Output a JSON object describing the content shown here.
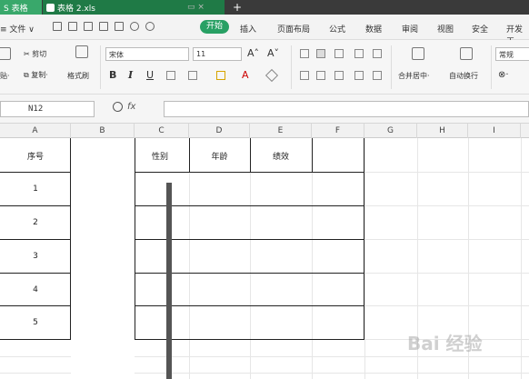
{
  "titlebar": {
    "app_tab": "S 表格",
    "doc_tab": "表格 2.xls",
    "add_tab_icon": "plus-icon"
  },
  "menubar": {
    "file_label": "≡ 文件 ∨",
    "tabs": [
      "开始",
      "插入",
      "页面布局",
      "公式",
      "数据",
      "审阅",
      "视图",
      "安全",
      "开发工"
    ]
  },
  "ribbon": {
    "cut_label": "剪切",
    "paste_label": "贴·",
    "copy_label": "复制·",
    "format_painter_label": "格式刷",
    "font_name": "宋体",
    "font_size": "11",
    "bold": "B",
    "italic": "I",
    "underline": "U",
    "merge_label": "合并居中·",
    "wrap_label": "自动换行",
    "number_format": "常规"
  },
  "formulabar": {
    "cell_ref": "N12",
    "fx_label": "fx",
    "formula_value": ""
  },
  "columns": [
    "A",
    "B",
    "C",
    "D",
    "E",
    "F",
    "G",
    "H",
    "I"
  ],
  "table": {
    "headers": [
      "序号",
      "性别",
      "年龄",
      "绩效"
    ],
    "rows": [
      "1",
      "2",
      "3",
      "4",
      "5"
    ]
  },
  "watermark": "Bai 经验",
  "colors": {
    "accent": "#28a064",
    "titlebar": "#3a3a3a"
  }
}
